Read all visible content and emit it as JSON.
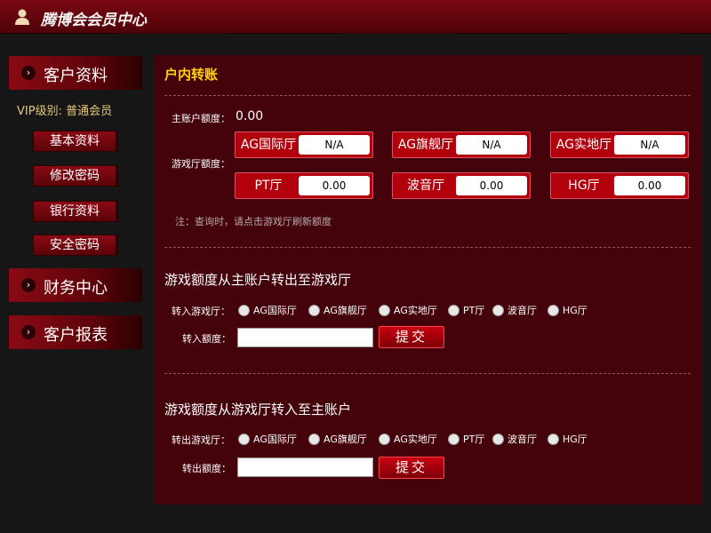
{
  "header": {
    "title": "腾博会会员中心",
    "icon": "user-icon"
  },
  "sidebar": {
    "customer_info": "客户资料",
    "vip_label": "VIP级别: 普通会员",
    "sub_items": [
      "基本资料",
      "修改密码",
      "银行资料",
      "安全密码"
    ],
    "finance_center": "财务中心",
    "customer_report": "客户报表"
  },
  "main": {
    "heading": "户内转账",
    "main_balance_label": "主账户额度：",
    "main_balance_value": "0.00",
    "game_balance_label": "游戏厅额度：",
    "halls": [
      {
        "name": "AG国际厅",
        "value": "N/A"
      },
      {
        "name": "AG旗舰厅",
        "value": "N/A"
      },
      {
        "name": "AG实地厅",
        "value": "N/A"
      },
      {
        "name": "PT厅",
        "value": "0.00"
      },
      {
        "name": "波音厅",
        "value": "0.00"
      },
      {
        "name": "HG厅",
        "value": "0.00"
      }
    ],
    "note": "注：查询时，请点击游戏厅刷新额度",
    "transfer_in": {
      "title": "游戏额度从主账户转出至游戏厅",
      "hall_label": "转入游戏厅：",
      "amount_label": "转入额度：",
      "amount_value": "",
      "submit": "提交"
    },
    "transfer_out": {
      "title": "游戏额度从游戏厅转入至主账户",
      "hall_label": "转出游戏厅：",
      "amount_label": "转出额度：",
      "amount_value": "",
      "submit": "提交"
    },
    "radio_options": [
      "AG国际厅",
      "AG旗舰厅",
      "AG实地厅",
      "PT厅",
      "波音厅",
      "HG厅"
    ]
  },
  "colors": {
    "accent": "#b3000d",
    "heading": "#ffd200",
    "panel": "#44020a",
    "background": "#161616"
  }
}
